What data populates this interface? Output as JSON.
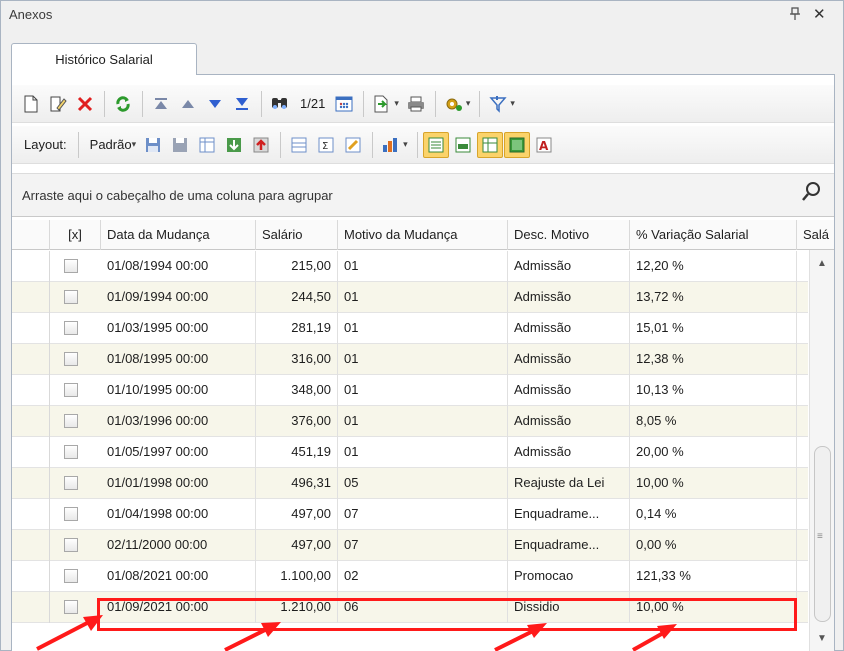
{
  "panel": {
    "title": "Anexos",
    "pin_glyph": "ꟷ",
    "close_glyph": "✕"
  },
  "tabs": [
    {
      "label": "Histórico Salarial",
      "active": true
    }
  ],
  "toolbar1": {
    "record_counter": "1/21",
    "icons": [
      "new-document-icon",
      "edit-icon",
      "delete-icon",
      "refresh-icon",
      "first-record-icon",
      "previous-record-icon",
      "next-record-icon",
      "last-record-icon",
      "find-icon",
      "calendar-icon",
      "export-icon",
      "print-icon",
      "settings-icon",
      "filter-icon"
    ]
  },
  "toolbar2": {
    "layout_label": "Layout:",
    "layout_value": "Padrão",
    "dropdown_glyph": "▾"
  },
  "group_panel": {
    "text": "Arraste aqui o cabeçalho de uma coluna para agrupar"
  },
  "grid": {
    "columns": [
      "[x]",
      "Data da Mudança",
      "Salário",
      "Motivo da Mudança",
      "Desc. Motivo",
      "% Variação Salarial",
      "Salá"
    ],
    "rows": [
      {
        "date": "01/08/1994 00:00",
        "salary": "215,00",
        "reason": "01",
        "desc": "Admissão",
        "variation": "12,20 %"
      },
      {
        "date": "01/09/1994 00:00",
        "salary": "244,50",
        "reason": "01",
        "desc": "Admissão",
        "variation": "13,72 %"
      },
      {
        "date": "01/03/1995 00:00",
        "salary": "281,19",
        "reason": "01",
        "desc": "Admissão",
        "variation": "15,01 %"
      },
      {
        "date": "01/08/1995 00:00",
        "salary": "316,00",
        "reason": "01",
        "desc": "Admissão",
        "variation": "12,38 %"
      },
      {
        "date": "01/10/1995 00:00",
        "salary": "348,00",
        "reason": "01",
        "desc": "Admissão",
        "variation": "10,13 %"
      },
      {
        "date": "01/03/1996 00:00",
        "salary": "376,00",
        "reason": "01",
        "desc": "Admissão",
        "variation": "8,05 %"
      },
      {
        "date": "01/05/1997 00:00",
        "salary": "451,19",
        "reason": "01",
        "desc": "Admissão",
        "variation": "20,00 %"
      },
      {
        "date": "01/01/1998 00:00",
        "salary": "496,31",
        "reason": "05",
        "desc": "Reajuste da Lei",
        "variation": "10,00 %"
      },
      {
        "date": "01/04/1998 00:00",
        "salary": "497,00",
        "reason": "07",
        "desc": "Enquadrame...",
        "variation": "0,14 %"
      },
      {
        "date": "02/11/2000 00:00",
        "salary": "497,00",
        "reason": "07",
        "desc": "Enquadrame...",
        "variation": "0,00 %"
      },
      {
        "date": "01/08/2021 00:00",
        "salary": "1.100,00",
        "reason": "02",
        "desc": "Promocao",
        "variation": "121,33 %"
      },
      {
        "date": "01/09/2021 00:00",
        "salary": "1.210,00",
        "reason": "06",
        "desc": "Dissidio",
        "variation": "10,00 %"
      }
    ]
  },
  "colors": {
    "annotation_red": "#ff1a1a",
    "alt_row": "#f7f6ea",
    "highlight_button": "#fbd36a"
  }
}
